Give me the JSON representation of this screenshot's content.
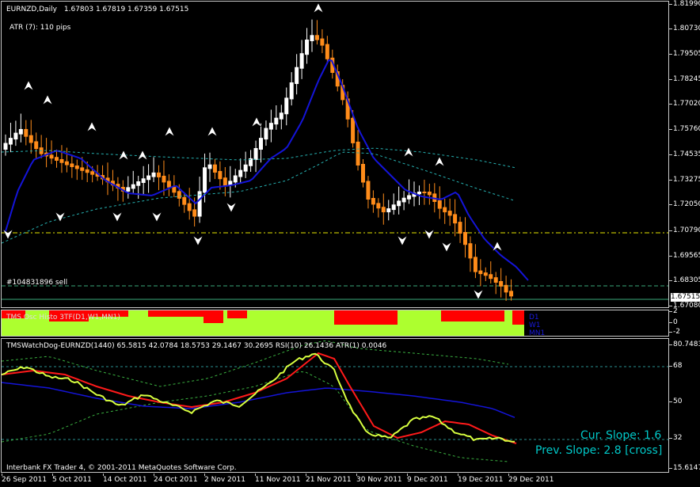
{
  "header": {
    "title": "EURNZD,Daily",
    "ohlc": "1.67803 1.67819 1.67359 1.67515"
  },
  "atr_label": "ATR (7):   110 pips",
  "order_label": "#104831896 sell",
  "histo_label": "TMS Osc Histo 3TF(D1,W1,MN1)",
  "histo_legend": [
    "D1",
    "W1",
    "MN1"
  ],
  "osc_label": "TMSWatchDog-EURNZD(1440) 65.5815 42.0784 18.5753 29.1467 30.2695  RSI(10) 26.1436  ATR(1) 0.0046",
  "copyright": "Interbank FX Trader 4, © 2001-2011 MetaQuotes Software Corp.",
  "slope": {
    "current": "Cur. Slope: 1.6",
    "previous": "Prev. Slope: 2.8 [cross]"
  },
  "price_axis": [
    "1.81990",
    "1.80730",
    "1.79505",
    "1.78245",
    "1.77020",
    "1.75760",
    "1.74535",
    "1.73275",
    "1.72050",
    "1.70790",
    "1.69565",
    "1.68305",
    "1.67080"
  ],
  "current_price": "1.67515",
  "histo_axis": [
    "2",
    "0",
    "-2"
  ],
  "osc_axis": [
    "80.7483",
    "68",
    "50",
    "32",
    "15.6147"
  ],
  "dates": [
    "26 Sep 2011",
    "5 Oct 2011",
    "14 Oct 2011",
    "24 Oct 2011",
    "2 Nov 2011",
    "11 Nov 2011",
    "21 Nov 2011",
    "30 Nov 2011",
    "9 Dec 2011",
    "19 Dec 2011",
    "29 Dec 2011"
  ],
  "colors": {
    "bull": "#ffffff",
    "bear": "#ff8c1a",
    "ma": "#1414d8",
    "histo_green": "#adff2f",
    "histo_red": "#ff0000",
    "line_yellow": "#d8ff40",
    "line_red": "#ff1a1a",
    "level": "#e8e800"
  }
}
